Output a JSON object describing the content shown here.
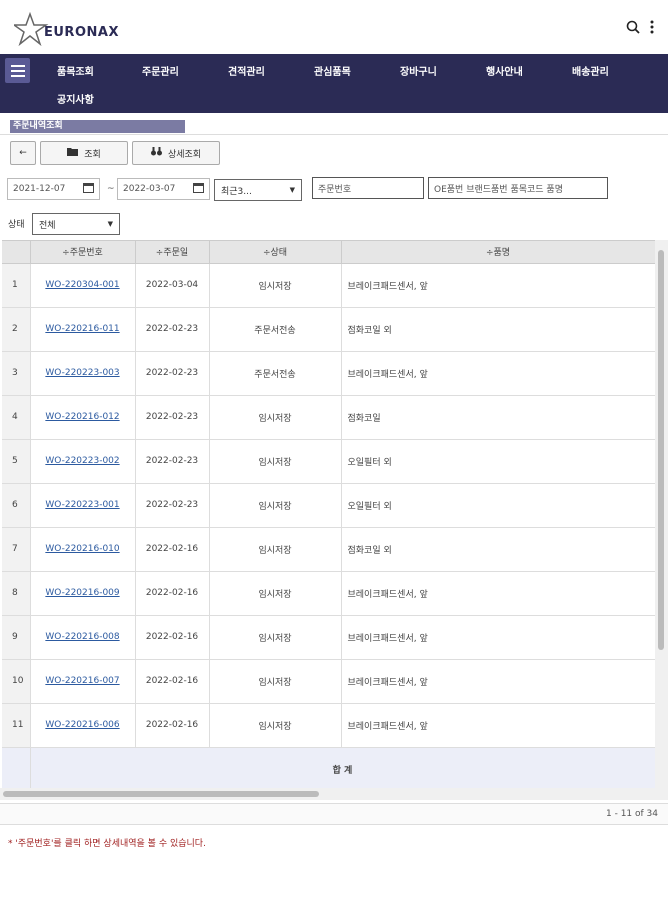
{
  "header": {
    "logo_text": "EURONAX",
    "search_icon": "search-icon",
    "more_icon": "kebab-icon"
  },
  "nav": {
    "menu_icon": "hamburger-icon",
    "items": [
      "품목조회",
      "주문관리",
      "견적관리",
      "관심품목",
      "장바구니",
      "행사안내",
      "배송관리",
      "공지사항"
    ]
  },
  "section": {
    "title": "주문내역조회"
  },
  "toolbar": {
    "back_icon": "arrow-left-icon",
    "search_label": "조회",
    "detail_label": "상세조회"
  },
  "filters": {
    "date_from": "2021-12-07",
    "date_to": "2022-03-07",
    "tilde": "~",
    "period": "최근3...",
    "order_no_placeholder": "주문번호",
    "part_placeholder": "OE품번 브랜드품번 품목코드 품명",
    "status_label": "상태",
    "status_value": "전체"
  },
  "table": {
    "columns": [
      "",
      "÷주문번호",
      "÷주문일",
      "÷상태",
      "÷품명"
    ],
    "rows": [
      {
        "n": "1",
        "order": "WO-220304-001",
        "date": "2022-03-04",
        "status": "임시저장",
        "item": "브레이크패드센서, 앞"
      },
      {
        "n": "2",
        "order": "WO-220216-011",
        "date": "2022-02-23",
        "status": "주문서전송",
        "item": "점화코일 외"
      },
      {
        "n": "3",
        "order": "WO-220223-003",
        "date": "2022-02-23",
        "status": "주문서전송",
        "item": "브레이크패드센서, 앞"
      },
      {
        "n": "4",
        "order": "WO-220216-012",
        "date": "2022-02-23",
        "status": "임시저장",
        "item": "점화코일"
      },
      {
        "n": "5",
        "order": "WO-220223-002",
        "date": "2022-02-23",
        "status": "임시저장",
        "item": "오일필터 외"
      },
      {
        "n": "6",
        "order": "WO-220223-001",
        "date": "2022-02-23",
        "status": "임시저장",
        "item": "오일필터 외"
      },
      {
        "n": "7",
        "order": "WO-220216-010",
        "date": "2022-02-16",
        "status": "임시저장",
        "item": "점화코일 외"
      },
      {
        "n": "8",
        "order": "WO-220216-009",
        "date": "2022-02-16",
        "status": "임시저장",
        "item": "브레이크패드센서, 앞"
      },
      {
        "n": "9",
        "order": "WO-220216-008",
        "date": "2022-02-16",
        "status": "임시저장",
        "item": "브레이크패드센서, 앞"
      },
      {
        "n": "10",
        "order": "WO-220216-007",
        "date": "2022-02-16",
        "status": "임시저장",
        "item": "브레이크패드센서, 앞"
      },
      {
        "n": "11",
        "order": "WO-220216-006",
        "date": "2022-02-16",
        "status": "임시저장",
        "item": "브레이크패드센서, 앞"
      }
    ],
    "summary_label": "합 계"
  },
  "pager": {
    "text": "1 - 11 of 34"
  },
  "note": {
    "text": "* '주문번호'를 클릭 하면 상세내역을 볼 수 있습니다."
  },
  "colors": {
    "nav_bg": "#2b2b55",
    "section_bg": "#7b7ba3",
    "link": "#2c5aa0"
  }
}
